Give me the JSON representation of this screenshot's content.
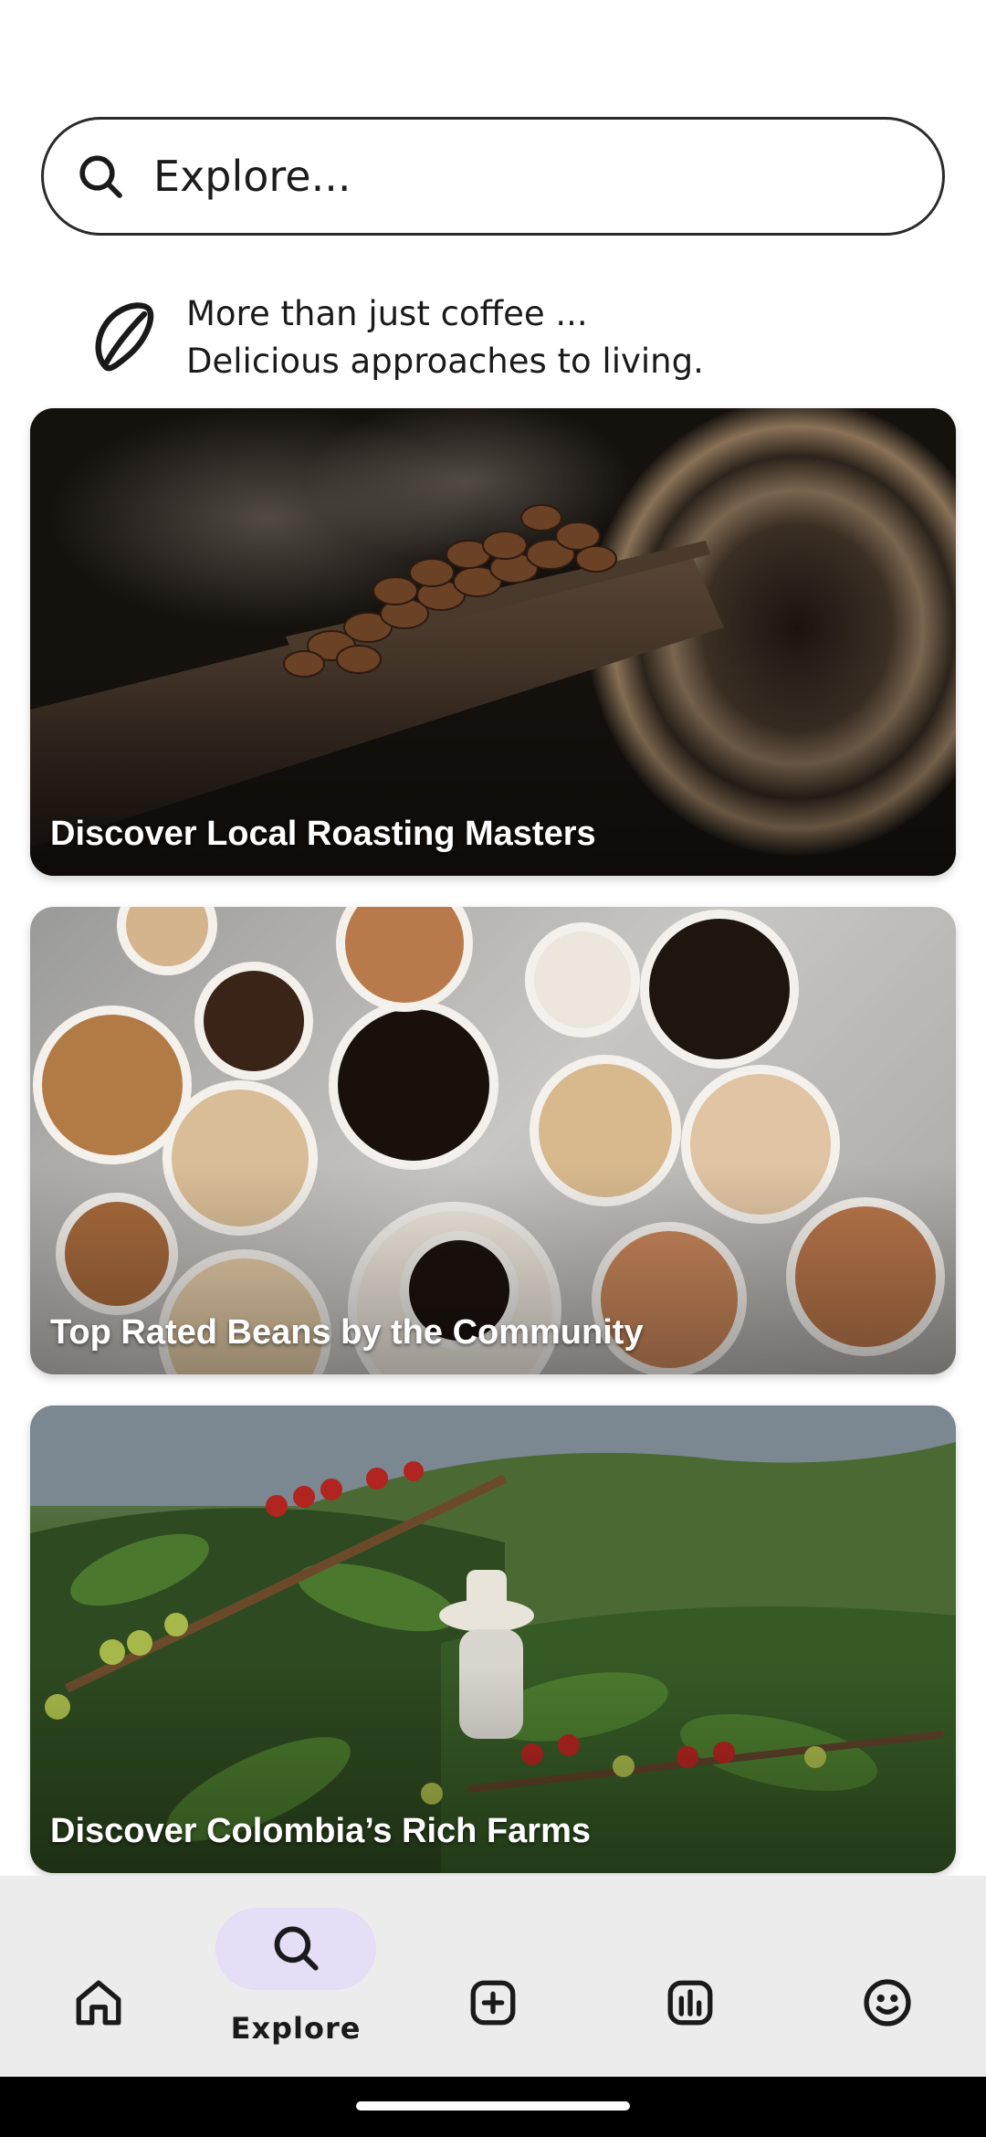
{
  "search": {
    "placeholder": "Explore..."
  },
  "tagline": {
    "line1": "More than just coffee ...",
    "line2": "Delicious approaches to living.",
    "icon": "coffee-bean-icon"
  },
  "cards": [
    {
      "label": "Discover Local Roasting Masters"
    },
    {
      "label": "Top Rated Beans by the Community"
    },
    {
      "label": "Discover Colombia’s Rich Farms"
    }
  ],
  "nav": {
    "items": [
      {
        "icon": "home-icon",
        "label": ""
      },
      {
        "icon": "search-icon",
        "label": "Explore",
        "active": true
      },
      {
        "icon": "add-icon",
        "label": ""
      },
      {
        "icon": "stats-icon",
        "label": ""
      },
      {
        "icon": "profile-icon",
        "label": ""
      }
    ],
    "active_color": "#e6ddf6",
    "background": "#ececec"
  }
}
